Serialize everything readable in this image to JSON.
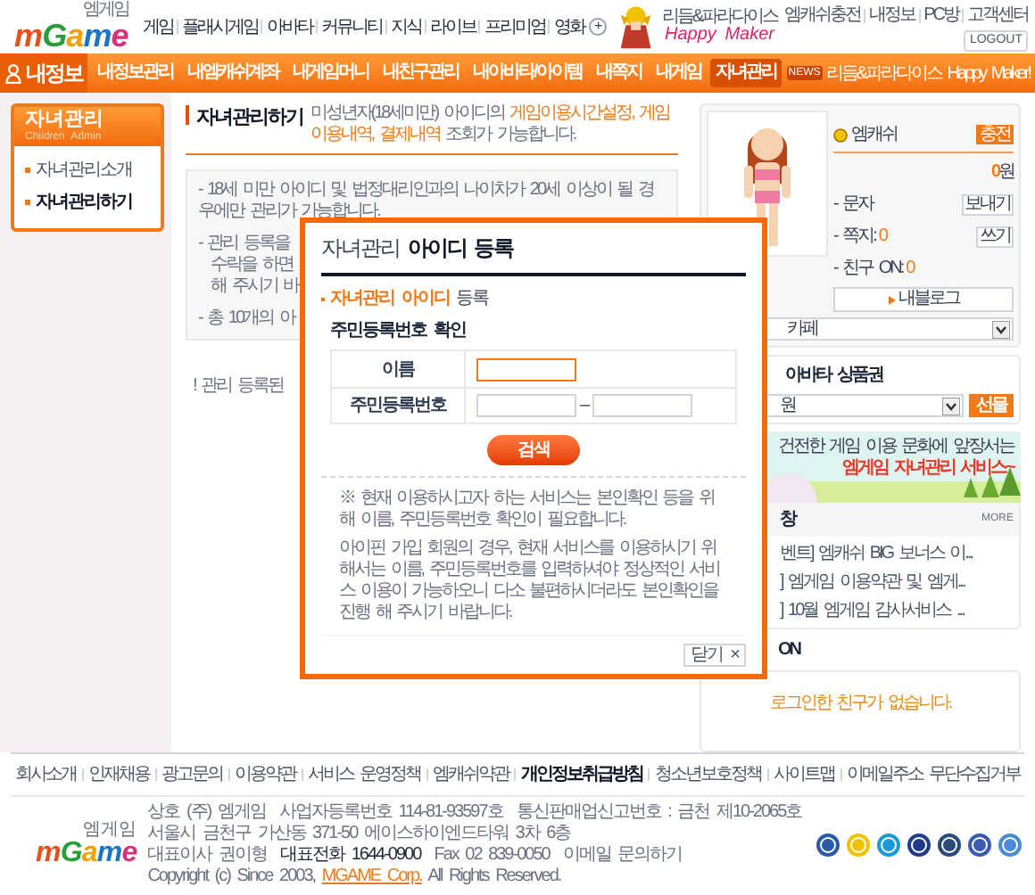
{
  "header": {
    "logo": "mGame",
    "logo_sub": "엠게임",
    "nav": [
      "게임",
      "플래시게임",
      "아바타",
      "커뮤니티",
      "지식",
      "라이브",
      "프리미엄",
      "영화"
    ],
    "nav_more": "+",
    "promo_small": "리듬&파라다이스",
    "promo_big": "Happy Maker",
    "links": [
      "엠캐쉬충전",
      "내정보",
      "PC방",
      "고객센터"
    ],
    "logout": "LOGOUT"
  },
  "menu_bar": {
    "title": "내정보",
    "items": [
      {
        "label": "내정보관리",
        "selected": false
      },
      {
        "label": "내엠캐쉬계좌",
        "selected": false
      },
      {
        "label": "내게임머니",
        "selected": false
      },
      {
        "label": "내친구관리",
        "selected": false
      },
      {
        "label": "내아바타/아이템",
        "selected": false
      },
      {
        "label": "내쪽지",
        "selected": false
      },
      {
        "label": "내게임",
        "selected": false
      },
      {
        "label": "자녀관리",
        "selected": true
      }
    ],
    "news_badge": "NEWS",
    "news": "리듬&파라다이스 Happy Maker!"
  },
  "sidebar": {
    "title": "자녀관리",
    "subtitle": "Children Admin",
    "items": [
      {
        "label": "자녀관리소개",
        "selected": false
      },
      {
        "label": "자녀관리하기",
        "selected": true
      }
    ]
  },
  "content": {
    "title": "자녀관리하기",
    "description": "미성년자(18세미만) 아이디의 **게임이용시간설정, 게임이용내역, 결제내역** 조회가 가능합니다.",
    "first_note": "- 18세 미만 아이디 및 법정대리인과의 나이차가 20세 이상이 될 경우에만 관리가 가능합니다.",
    "notes": [
      [
        "- 관리 등록을",
        "수락을 하면",
        "해 주시기 바"
      ],
      [
        "- 총 10개의 아"
      ]
    ],
    "footnote": "! 관리 등록된"
  },
  "modal": {
    "title_plain": "자녀관리",
    "title_bold": "아이디 등록",
    "section_highlight": "자녀관리 아이디",
    "section_rest": "등록",
    "form_title": "주민등록번호 확인",
    "fields": [
      {
        "label": "이름",
        "kind": "single",
        "focused": true
      },
      {
        "label": "주민등록번호",
        "kind": "split",
        "focused": false,
        "separator": "–"
      }
    ],
    "search_button": "검색",
    "notes": [
      "※ 현재 이용하시고자 하는 서비스는 본인확인 등을 위해 이름, 주민등록번호 확인이 필요합니다.",
      "아이핀 가입 회원의 경우, 현재 서비스를 이용하시기 위해서는 이름, 주민등록번호를 입력하셔야 정상적인 서비스 이용이 가능하오니 다소 불편하시더라도 본인확인을 진행 해 주시기 바랍니다."
    ],
    "close": "닫기",
    "close_x": "×"
  },
  "right_panel": {
    "cash_label": "엠캐쉬",
    "charge": "충전",
    "cash_amount": "0",
    "cash_unit": "원",
    "rows": [
      {
        "label": "- 문자",
        "button": "보내기"
      },
      {
        "label": "- 쪽지:",
        "count": "0",
        "button": "쓰기"
      },
      {
        "label": "- 친구 ON:",
        "count": "0"
      }
    ],
    "blog": "내블로그",
    "cafe_select": "카페",
    "gift_title": "아바타 상품권",
    "gift_select": "원",
    "gift_button": "선물",
    "banner": {
      "line1": "건전한 게임 이용 문화에 앞장서는",
      "line2": "엠게임 자녀관리 서비스~"
    },
    "notice": {
      "title": "창",
      "more": "MORE",
      "items": [
        "벤트] 엠캐쉬 BIG 보너스 이...",
        "] 엠게임 이용약관 및 엠게...",
        "] 10월 엠게임 감사서비스 ..."
      ]
    },
    "friends": {
      "title": "ON",
      "empty": "로그인한 친구가 없습니다."
    }
  },
  "footer": {
    "links": [
      {
        "label": "회사소개",
        "bold": false
      },
      {
        "label": "인재채용",
        "bold": false
      },
      {
        "label": "광고문의",
        "bold": false
      },
      {
        "label": "이용약관",
        "bold": false
      },
      {
        "label": "서비스 운영정책",
        "bold": false
      },
      {
        "label": "엠캐쉬약관",
        "bold": false
      },
      {
        "label": "개인정보취급방침",
        "bold": true
      },
      {
        "label": "청소년보호정책",
        "bold": false
      },
      {
        "label": "사이트맵",
        "bold": false
      },
      {
        "label": "이메일주소 무단수집거부",
        "bold": false
      }
    ],
    "logo": "mGame",
    "logo_sub": "엠게임",
    "info": [
      "상호 (주) 엠게임  사업자등록번호 114-81-93597호  통신판매업신고번호 : 금천 제10-2065호",
      "서울시 금천구 가산동 371-50 에이스하이엔드타워 3차 6층",
      "대표이사 권이형  **대표전화 1644-0900**  Fax 02 839-0050  이메일 문의하기",
      "Copyright (c) Since 2003, **MGAME Corp.** All Rights Reserved."
    ]
  }
}
